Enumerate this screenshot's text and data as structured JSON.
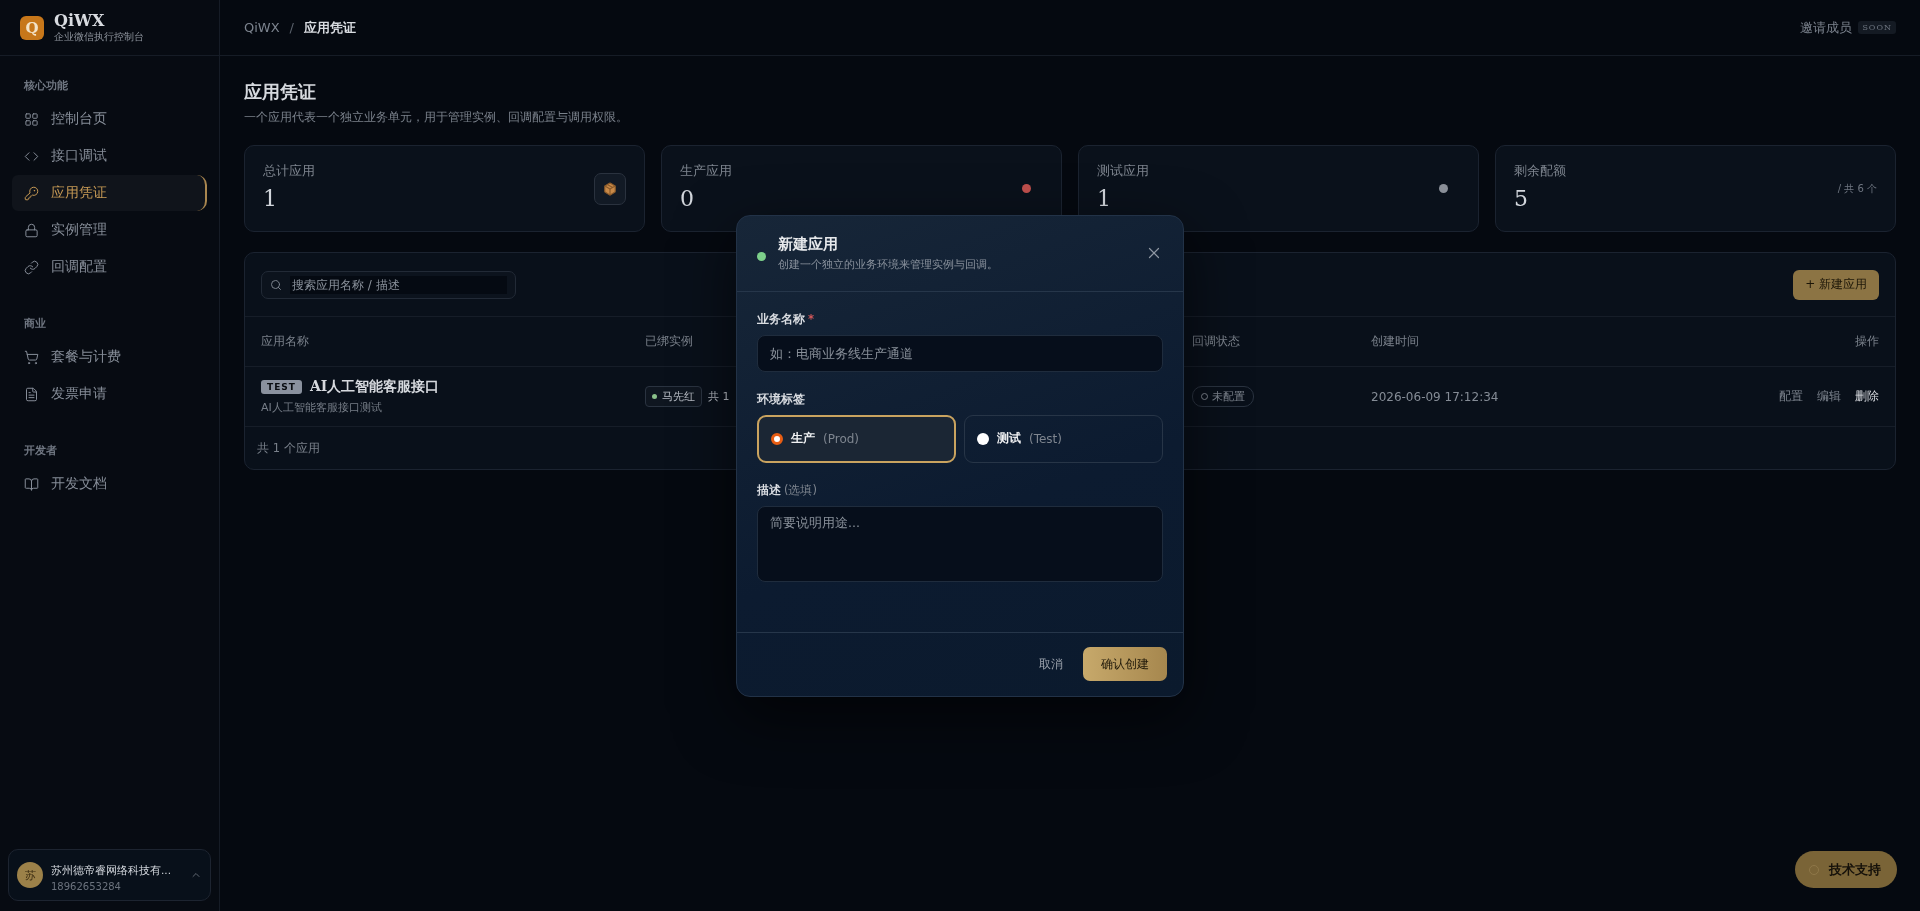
{
  "brand": {
    "logo": "Q",
    "name": "QiWX",
    "subtitle": "企业微信执行控制台"
  },
  "sidebar": {
    "sections": [
      {
        "title": "核心功能",
        "items": [
          {
            "label": "控制台页",
            "selected": false
          },
          {
            "label": "接口调试",
            "selected": false
          },
          {
            "label": "应用凭证",
            "selected": true
          },
          {
            "label": "实例管理",
            "selected": false
          },
          {
            "label": "回调配置",
            "selected": false
          }
        ]
      },
      {
        "title": "商业",
        "items": [
          {
            "label": "套餐与计费",
            "selected": false
          },
          {
            "label": "发票申请",
            "selected": false
          }
        ]
      },
      {
        "title": "开发者",
        "items": [
          {
            "label": "开发文档",
            "selected": false
          }
        ]
      }
    ]
  },
  "account": {
    "avatar": "苏",
    "name": "苏州德帝睿网络科技有...",
    "phone": "18962653284"
  },
  "header": {
    "breadcrumb": [
      "QiWX",
      "应用凭证"
    ],
    "breadcrumb_separator": "/",
    "invite": "邀请成员",
    "invite_badge": "SOON"
  },
  "page": {
    "title": "应用凭证",
    "subtitle": "一个应用代表一个独立业务单元，用于管理实例、回调配置与调用权限。"
  },
  "stats": [
    {
      "label": "总计应用",
      "value": "1",
      "kind": "icon"
    },
    {
      "label": "生产应用",
      "value": "0",
      "kind": "dot",
      "color": "#c0504d"
    },
    {
      "label": "测试应用",
      "value": "1",
      "kind": "dot",
      "color": "#8a8f98"
    },
    {
      "label": "剩余配额",
      "value": "5",
      "kind": "note",
      "note": "/ 共 6 个"
    }
  ],
  "table": {
    "search_placeholder": "搜索应用名称 / 描述",
    "new_button": "+ 新建应用",
    "columns": [
      "应用名称",
      "已绑实例",
      "回调状态",
      "创建时间",
      "操作"
    ],
    "rows": [
      {
        "env_badge": "TEST",
        "name": "AI人工智能客服接口",
        "description": "AI人工智能客服接口测试",
        "instance": "马先红",
        "instance_count": "共 1",
        "callback_status": "未配置",
        "created": "2026-06-09 17:12:34",
        "actions": [
          "配置",
          "编辑",
          "删除"
        ]
      }
    ],
    "footer": "共 1 个应用"
  },
  "modal": {
    "title": "新建应用",
    "subtitle": "创建一个独立的业务环境来管理实例与回调。",
    "name_field": {
      "label": "业务名称",
      "required_mark": "*",
      "placeholder": "如：电商业务线生产通道"
    },
    "env_label": "环境标签",
    "env_options": [
      {
        "label": "生产",
        "code": "(Prod)",
        "selected": true
      },
      {
        "label": "测试",
        "code": "(Test)",
        "selected": false
      }
    ],
    "desc_field": {
      "label": "描述",
      "hint": "(选填)",
      "placeholder": "简要说明用途..."
    },
    "cancel": "取消",
    "confirm": "确认创建"
  },
  "support_button": "技术支持"
}
